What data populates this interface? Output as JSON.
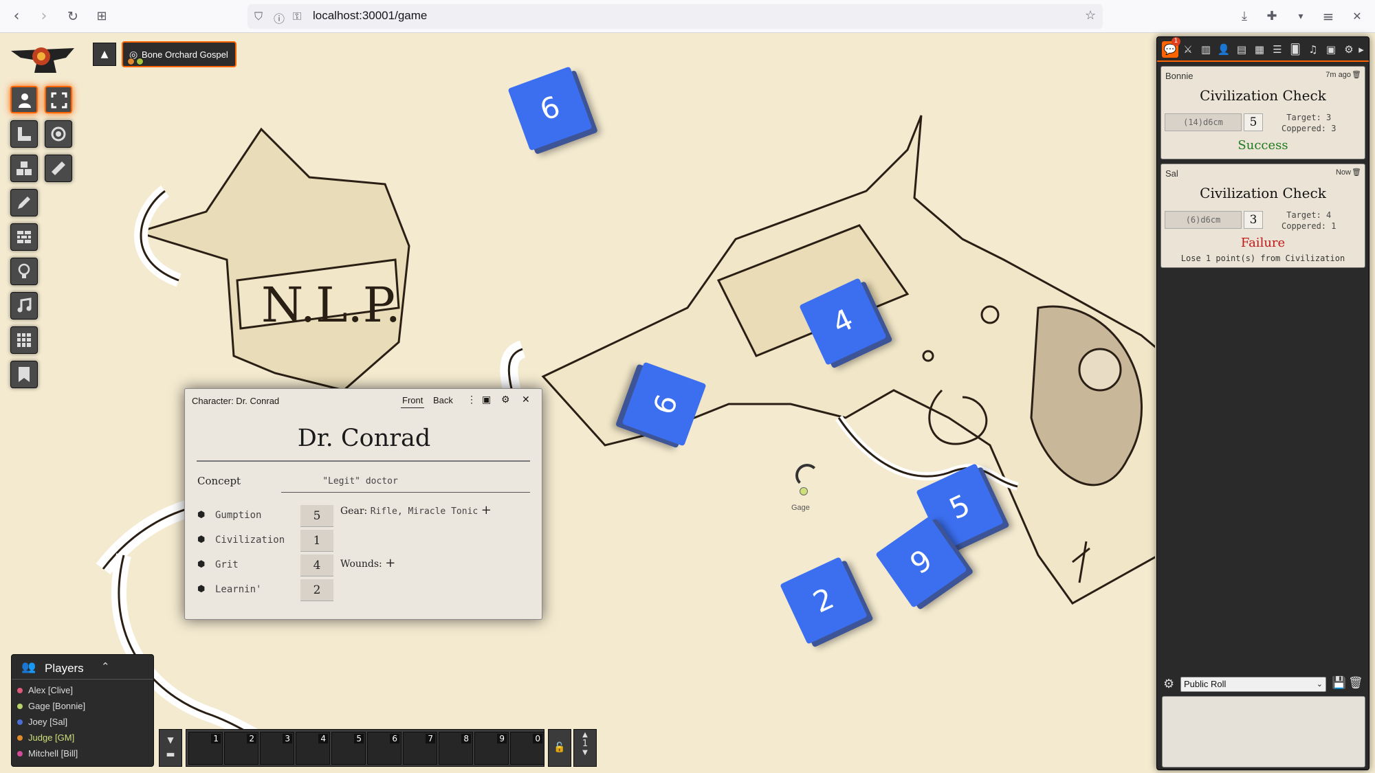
{
  "browser": {
    "url": "localhost:30001/game",
    "nav_icons": [
      "back-icon",
      "forward-icon",
      "reload-icon",
      "new-tab-icon"
    ]
  },
  "scene": {
    "active_scene_label": "Bone Orchard Gospel",
    "scene_dots": [
      {
        "letter": "J",
        "color": "#e08a2c"
      },
      {
        "letter": "G",
        "color": "#a8c43a"
      }
    ]
  },
  "controls": {
    "left_column": [
      "token-controls",
      "measure",
      "tiles",
      "drawings",
      "walls",
      "lighting",
      "sounds",
      "regions",
      "notes"
    ],
    "right_column": [
      "fullscreen",
      "target",
      "ruler"
    ]
  },
  "dice": [
    "6",
    "4",
    "9",
    "5",
    "9",
    "2"
  ],
  "token": {
    "label": "Gage"
  },
  "character_sheet": {
    "window_title": "Character: Dr. Conrad",
    "tab_front": "Front",
    "tab_back": "Back",
    "name": "Dr. Conrad",
    "concept_label": "Concept",
    "concept_value": "\"Legit\" doctor",
    "attributes": [
      {
        "label": "Gumption",
        "value": "5"
      },
      {
        "label": "Civilization",
        "value": "1"
      },
      {
        "label": "Grit",
        "value": "4"
      },
      {
        "label": "Learnin'",
        "value": "2"
      }
    ],
    "gear_label": "Gear:",
    "gear_value": "Rifle, Miracle Tonic",
    "wounds_label": "Wounds:"
  },
  "players": {
    "title": "Players",
    "list": [
      {
        "name": "Alex [Clive]",
        "color": "#e05a7a"
      },
      {
        "name": "Gage [Bonnie]",
        "color": "#b9d36a"
      },
      {
        "name": "Joey [Sal]",
        "color": "#4a6fd4"
      },
      {
        "name": "Judge [GM]",
        "color": "#e08a2c"
      },
      {
        "name": "Mitchell [Bill]",
        "color": "#d34a9a"
      }
    ]
  },
  "hotbar": {
    "slots": [
      "1",
      "2",
      "3",
      "4",
      "5",
      "6",
      "7",
      "8",
      "9",
      "0"
    ],
    "page": "1"
  },
  "chat": {
    "notification_count": "1",
    "messages": [
      {
        "speaker": "Bonnie",
        "time": "7m ago",
        "title": "Civilization Check",
        "formula": "(14)d6cm",
        "total": "5",
        "target": "Target: 3",
        "coppered": "Coppered: 3",
        "outcome": "Success",
        "outcome_color": "#1e7a1e",
        "extra": ""
      },
      {
        "speaker": "Sal",
        "time": "Now",
        "title": "Civilization Check",
        "formula": "(6)d6cm",
        "total": "3",
        "target": "Target: 4",
        "coppered": "Coppered: 1",
        "outcome": "Failure",
        "outcome_color": "#c01818",
        "extra": "Lose 1 point(s) from Civilization"
      }
    ],
    "roll_mode": "Public Roll"
  }
}
